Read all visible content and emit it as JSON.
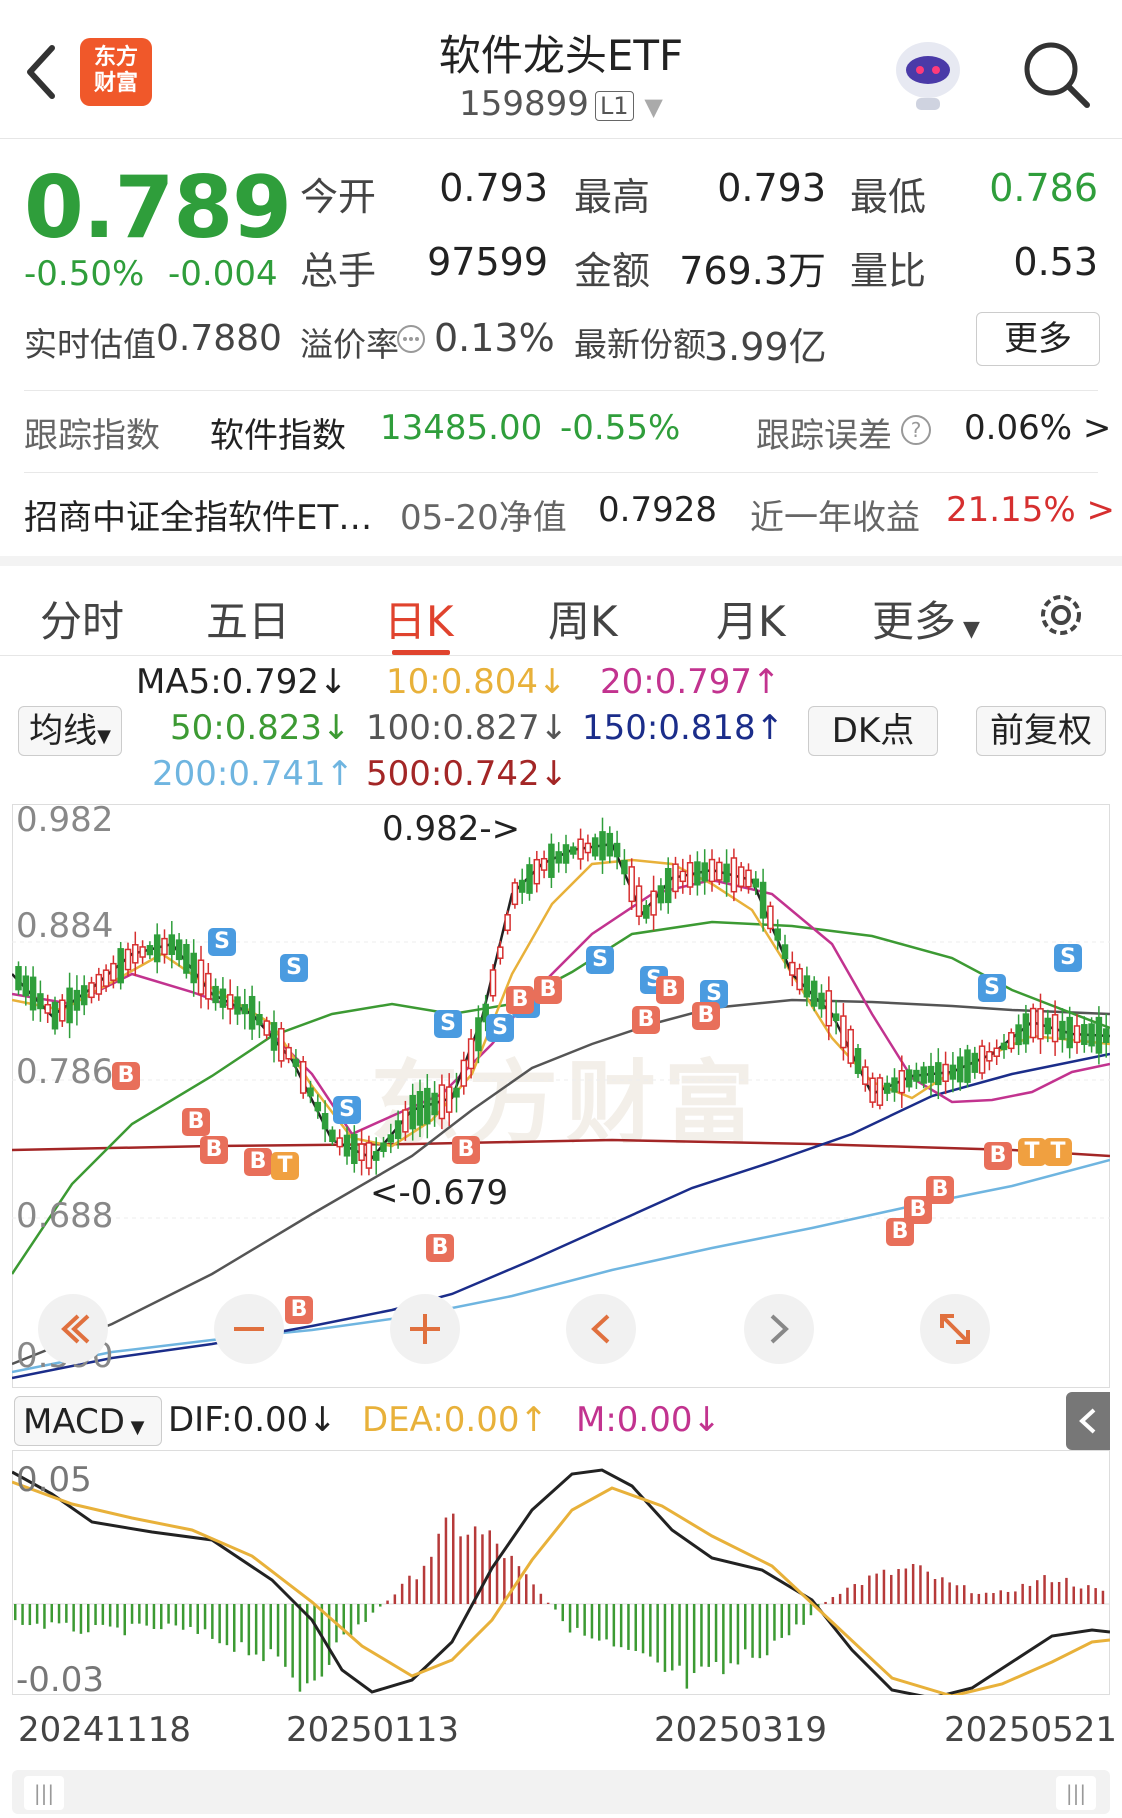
{
  "header": {
    "logo_line1": "东方",
    "logo_line2": "财富",
    "title": "软件龙头ETF",
    "code": "159899",
    "level": "L1"
  },
  "quote": {
    "price": "0.789",
    "change_pct": "-0.50%",
    "change": "-0.004",
    "open_label": "今开",
    "open": "0.793",
    "high_label": "最高",
    "high": "0.793",
    "low_label": "最低",
    "low": "0.786",
    "volume_label": "总手",
    "volume": "97599",
    "amount_label": "金额",
    "amount": "769.3万",
    "vol_ratio_label": "量比",
    "vol_ratio": "0.53",
    "iopv_label": "实时估值",
    "iopv": "0.7880",
    "premium_label": "溢价率",
    "premium": "0.13%",
    "shares_label": "最新份额",
    "shares": "3.99亿",
    "more_label": "更多"
  },
  "tracking": {
    "label": "跟踪指数",
    "index_name": "软件指数",
    "index_value": "13485.00",
    "index_change": "-0.55%",
    "error_label": "跟踪误差",
    "error_value": "0.06% >"
  },
  "fund": {
    "name": "招商中证全指软件ET…",
    "nav_label": "05-20净值",
    "nav": "0.7928",
    "return_label": "近一年收益",
    "return_value": "21.15% >"
  },
  "tabs": [
    "分时",
    "五日",
    "日K",
    "周K",
    "月K",
    "更多"
  ],
  "active_tab": "日K",
  "ma": {
    "ma5": "MA5:0.792↓",
    "ma10": "10:0.804↓",
    "ma20": "20:0.797↑",
    "ma50": "50:0.823↓",
    "ma100": "100:0.827↓",
    "ma150": "150:0.818↑",
    "ma200": "200:0.741↑",
    "ma500": "500:0.742↓",
    "junxian": "均线",
    "dk": "DK点",
    "fq": "前复权"
  },
  "chart": {
    "y_top": "0.982",
    "y_2": "0.884",
    "y_3": "0.786",
    "y_4": "0.688",
    "y_bottom": "0.590",
    "high_marker": "0.982->",
    "low_marker": "<-0.679",
    "watermark": "东方财富"
  },
  "macd": {
    "label": "MACD",
    "dif": "DIF:0.00↓",
    "dea": "DEA:0.00↑",
    "m": "M:0.00↓",
    "y_top": "0.05",
    "y_bottom": "-0.03"
  },
  "dates": [
    "20241118",
    "20250113",
    "20250319",
    "20250521"
  ],
  "colors": {
    "up": "#d62f2f",
    "down": "#2f9e3b",
    "accent": "#e0432e",
    "ma5": "#222222",
    "ma10": "#e8b13a",
    "ma20": "#c2338f",
    "ma50": "#3c9a33",
    "ma100": "#555555",
    "ma150": "#1b2d8a",
    "ma200": "#6fb5e0",
    "ma500": "#a32626"
  }
}
